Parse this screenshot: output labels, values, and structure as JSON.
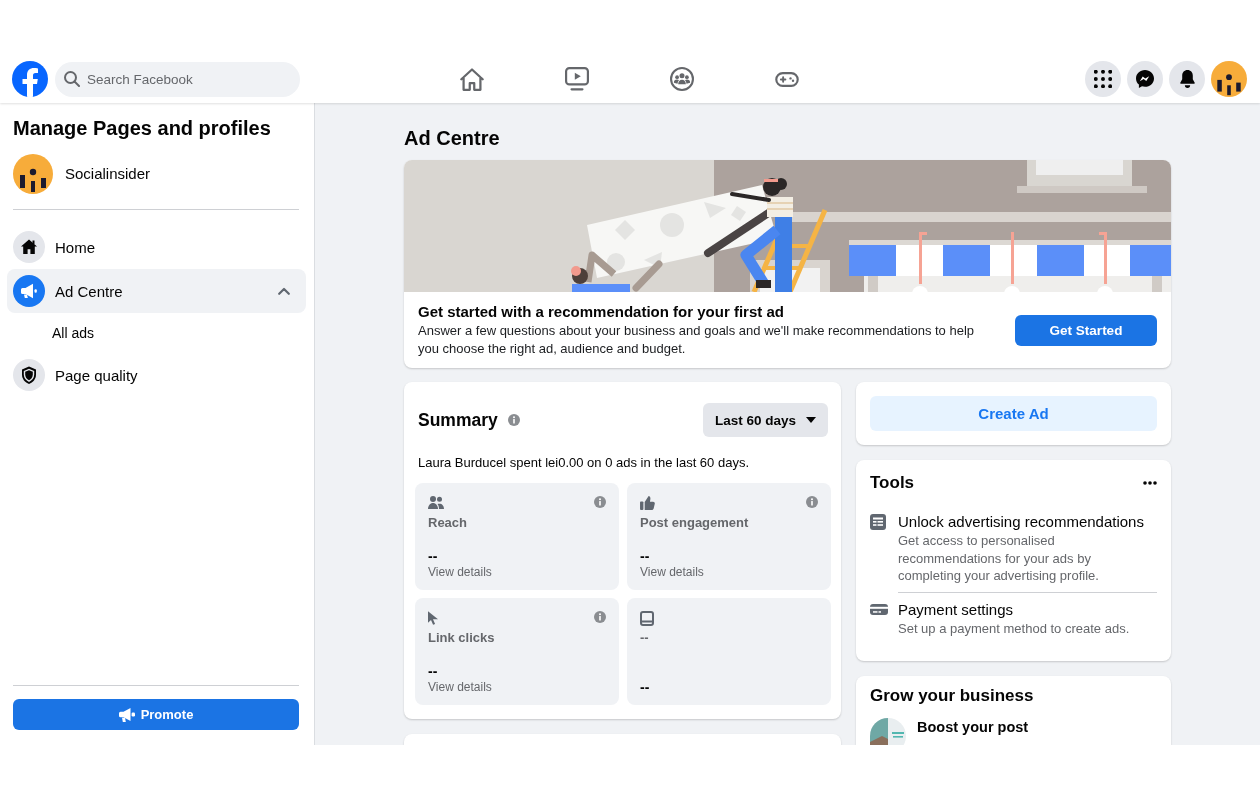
{
  "header": {
    "search": {
      "placeholder": "Search Facebook"
    }
  },
  "sidebar": {
    "title": "Manage Pages and profiles",
    "page": {
      "name": "Socialinsider"
    },
    "items": [
      {
        "label": "Home",
        "selected": false
      },
      {
        "label": "Ad Centre",
        "selected": true,
        "expanded": true,
        "children": [
          {
            "label": "All ads",
            "selected": false
          }
        ]
      },
      {
        "label": "Page quality",
        "selected": false
      }
    ],
    "promote_button": "Promote"
  },
  "main": {
    "title": "Ad Centre",
    "banner": {
      "title": "Get started with a recommendation for your first ad",
      "text": "Answer a few questions about your business and goals and we'll make recommendations to help you choose the right ad, audience and budget.",
      "button": "Get Started"
    },
    "summary": {
      "title": "Summary",
      "period": "Last 60 days",
      "text": "Laura Burducel spent lei0.00 on 0 ads in the last 60 days.",
      "metrics": [
        {
          "label": "Reach",
          "value": "--",
          "link": "View details",
          "info": true
        },
        {
          "label": "Post engagement",
          "value": "--",
          "link": "View details",
          "info": true
        },
        {
          "label": "Link clicks",
          "value": "--",
          "link": "View details",
          "info": true
        },
        {
          "label": "--",
          "value": "--",
          "info": false
        }
      ]
    },
    "create_ad_button": "Create Ad",
    "tools": {
      "title": "Tools",
      "items": [
        {
          "title": "Unlock advertising recommendations",
          "text": "Get access to personalised recommendations for your ads by completing your advertising profile."
        },
        {
          "title": "Payment settings",
          "text": "Set up a payment method to create ads."
        }
      ]
    },
    "grow": {
      "title": "Grow your business",
      "items": [
        {
          "title": "Boost your post"
        }
      ]
    }
  }
}
